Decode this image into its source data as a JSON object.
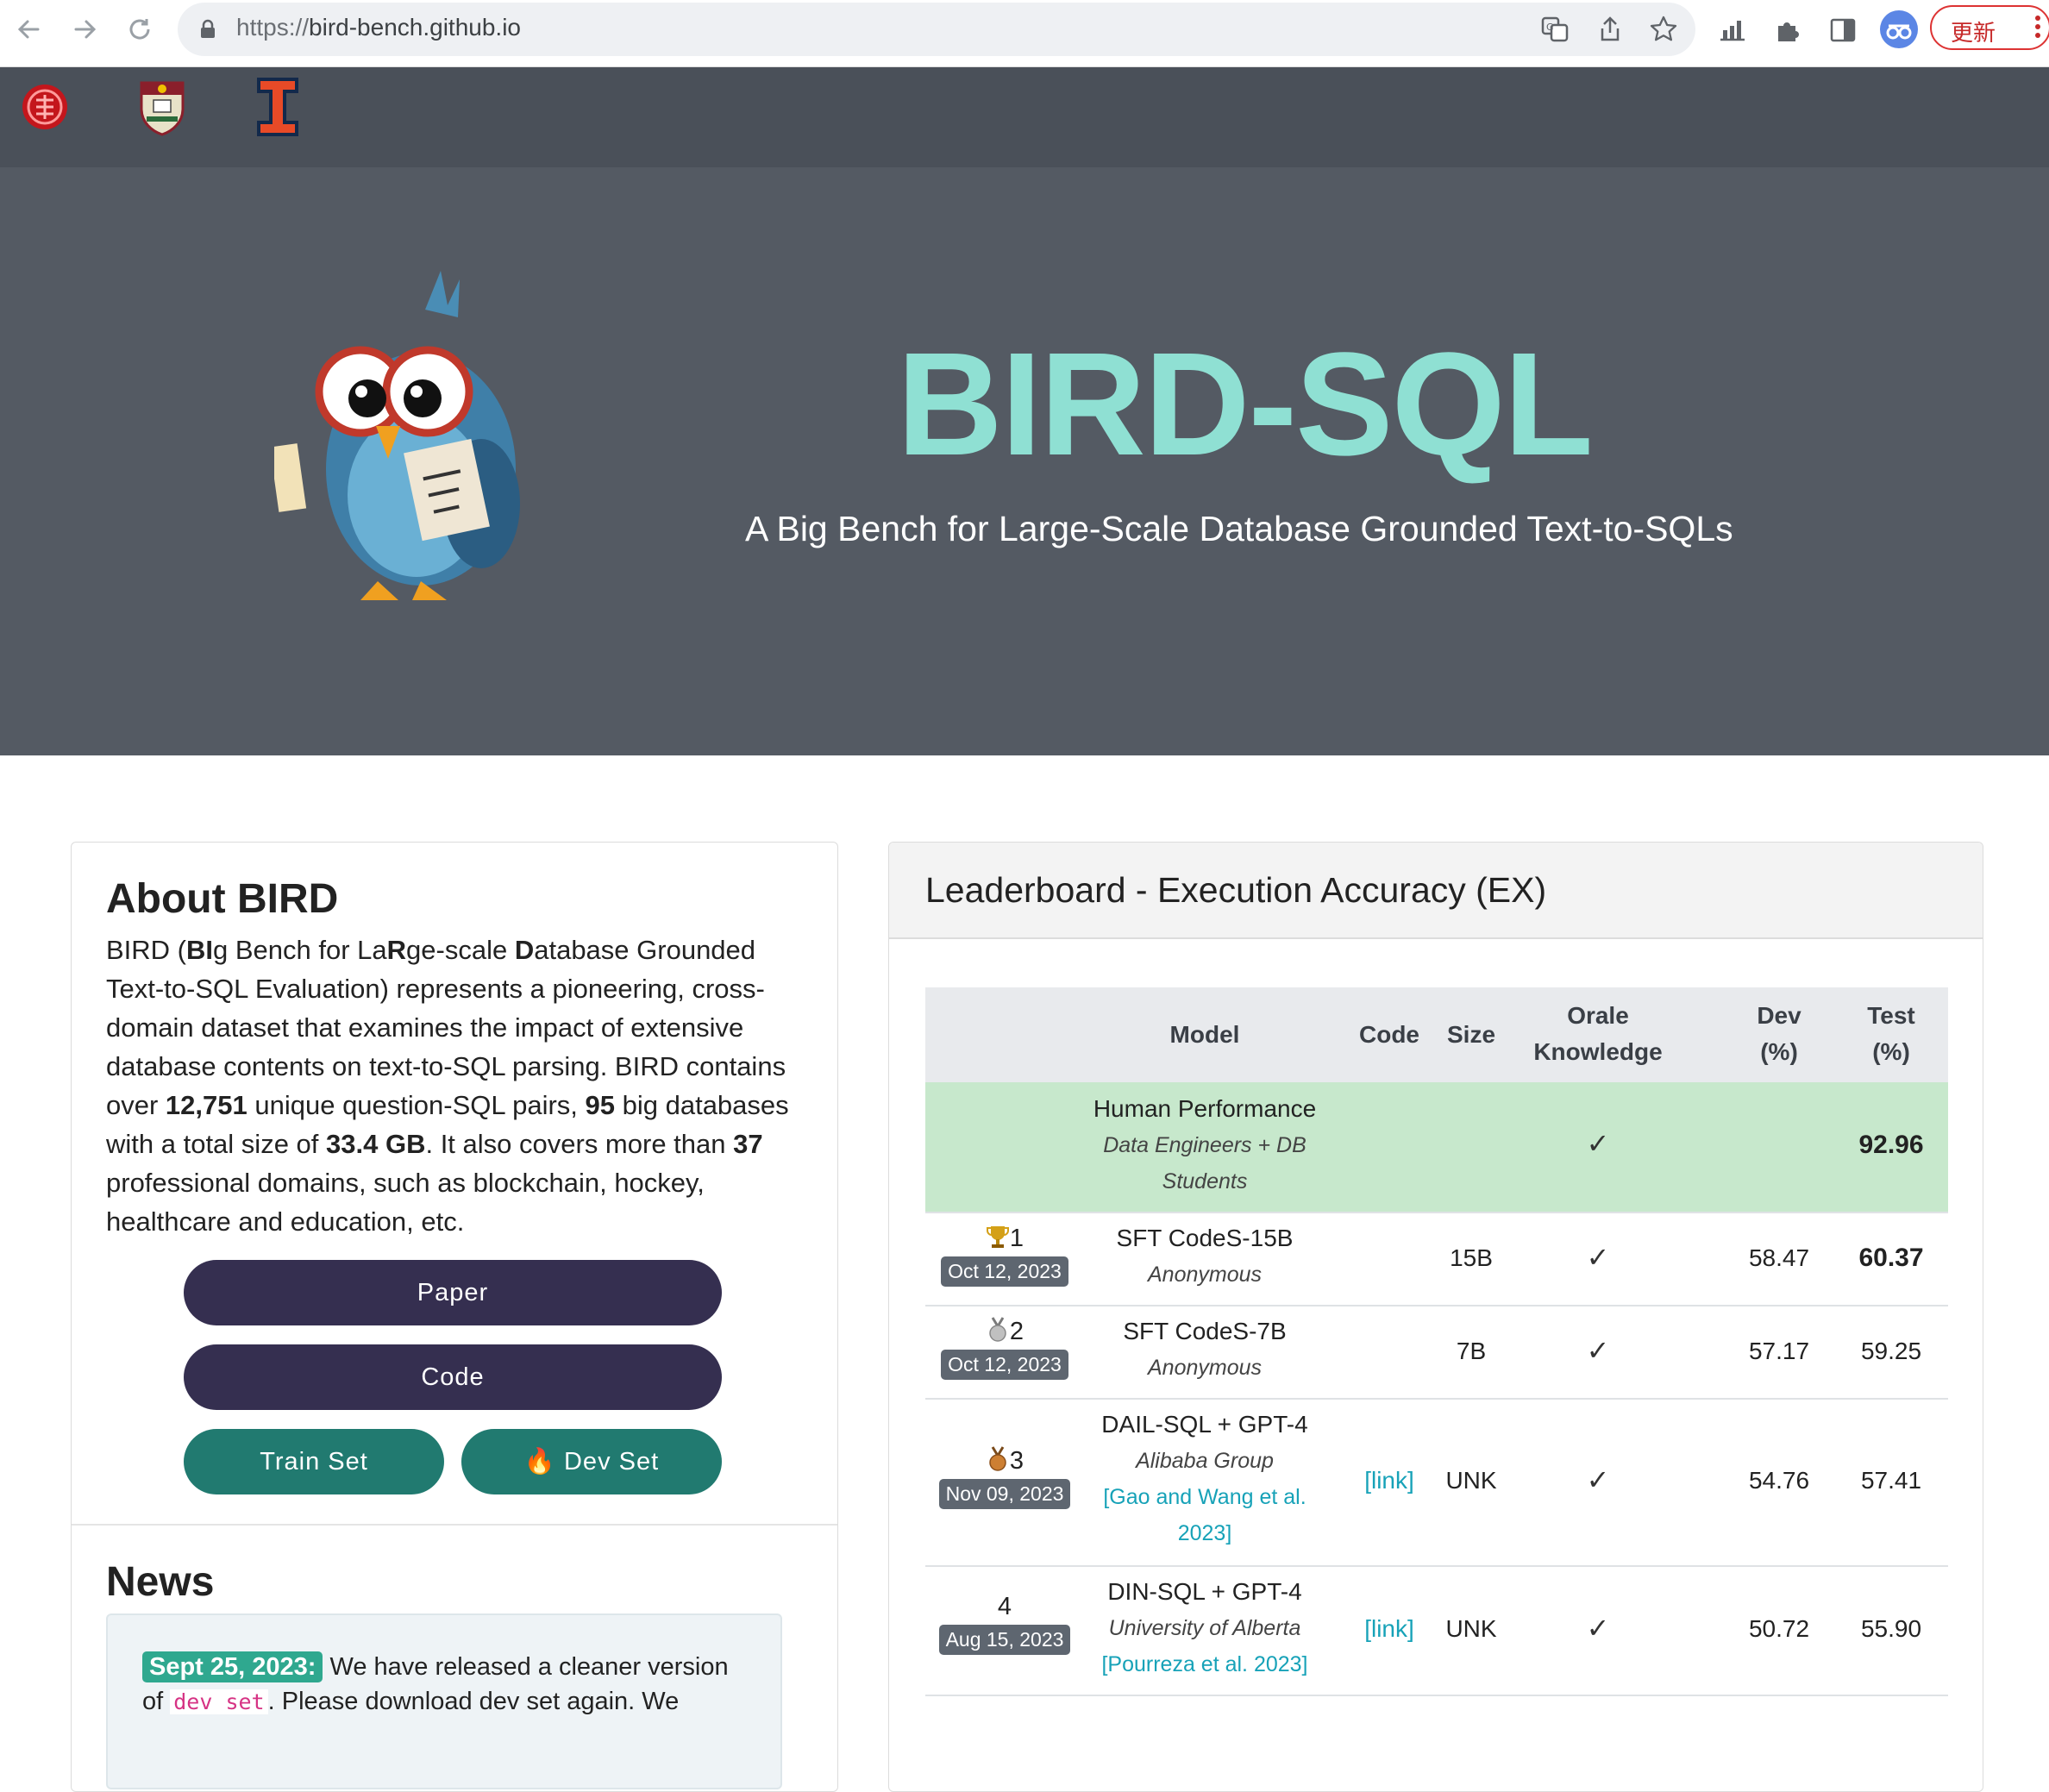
{
  "browser": {
    "url_scheme": "https://",
    "url_host": "bird-bench.github.io",
    "update_label": "更新"
  },
  "hero": {
    "title": "BIRD-SQL",
    "subtitle": "A Big Bench for Large-Scale Database Grounded Text-to-SQLs"
  },
  "about": {
    "title": "About BIRD",
    "text_segments": {
      "s1": "BIRD (",
      "s2": "BI",
      "s3": "g Bench for La",
      "s4": "R",
      "s5": "ge-scale ",
      "s6": "D",
      "s7": "atabase Grounded Text-to-SQL Evaluation) represents a pioneering, cross-domain dataset that examines the impact of extensive database contents on text-to-SQL parsing. BIRD contains over ",
      "n1": "12,751",
      "s8": " unique question-SQL pairs, ",
      "n2": "95",
      "s9": " big databases with a total size of ",
      "n3": "33.4 GB",
      "s10": ". It also covers more than ",
      "n4": "37",
      "s11": " professional domains, such as blockchain, hockey, healthcare and education, etc."
    },
    "buttons": {
      "paper": "Paper",
      "code": "Code",
      "train": "Train Set",
      "dev": "🔥 Dev Set"
    }
  },
  "news": {
    "title": "News",
    "date": "Sept 25, 2023:",
    "line1": "We have released a cleaner version",
    "line2_pre": "of",
    "line2_code": "dev set",
    "line2_post": ". Please download dev set again. We"
  },
  "leaderboard": {
    "title": "Leaderboard - Execution Accuracy (EX)",
    "headers": {
      "model": "Model",
      "code": "Code",
      "size": "Size",
      "oracle_1": "Orale",
      "oracle_2": "Knowledge",
      "dev_1": "Dev",
      "dev_2": "(%)",
      "test_1": "Test",
      "test_2": "(%)"
    },
    "human": {
      "model": "Human Performance",
      "org": "Data Engineers + DB Students",
      "oracle": "✓",
      "test": "92.96"
    },
    "rows": [
      {
        "rank": "1",
        "date": "Oct 12, 2023",
        "model": "SFT CodeS-15B",
        "org": "Anonymous",
        "ref": "",
        "code": "",
        "size": "15B",
        "oracle": "✓",
        "dev": "58.47",
        "test": "60.37"
      },
      {
        "rank": "2",
        "date": "Oct 12, 2023",
        "model": "SFT CodeS-7B",
        "org": "Anonymous",
        "ref": "",
        "code": "",
        "size": "7B",
        "oracle": "✓",
        "dev": "57.17",
        "test": "59.25"
      },
      {
        "rank": "3",
        "date": "Nov 09, 2023",
        "model": "DAIL-SQL + GPT-4",
        "org": "Alibaba Group",
        "ref": "[Gao and Wang et al. 2023]",
        "code": "[link]",
        "size": "UNK",
        "oracle": "✓",
        "dev": "54.76",
        "test": "57.41"
      },
      {
        "rank": "4",
        "date": "Aug 15, 2023",
        "model": "DIN-SQL + GPT-4",
        "org": "University of Alberta",
        "ref": "[Pourreza et al. 2023]",
        "code": "[link]",
        "size": "UNK",
        "oracle": "✓",
        "dev": "50.72",
        "test": "55.90"
      }
    ]
  }
}
